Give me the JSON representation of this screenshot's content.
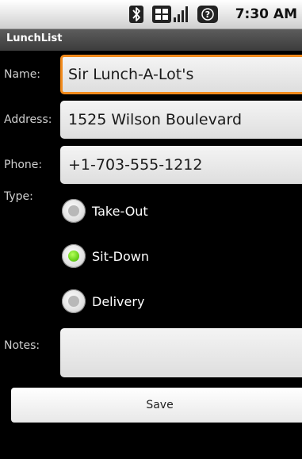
{
  "status_bar": {
    "time": "7:30 AM",
    "icons": [
      "bluetooth-icon",
      "data-icon",
      "signal-icon",
      "battery-icon"
    ]
  },
  "app": {
    "title": "LunchList"
  },
  "form": {
    "name_label": "Name:",
    "name_value": "Sir Lunch-A-Lot's",
    "address_label": "Address:",
    "address_value": "1525 Wilson Boulevard",
    "phone_label": "Phone:",
    "phone_value": "+1-703-555-1212",
    "type_label": "Type:",
    "type_options": [
      {
        "label": "Take-Out",
        "checked": false
      },
      {
        "label": "Sit-Down",
        "checked": true
      },
      {
        "label": "Delivery",
        "checked": false
      }
    ],
    "notes_label": "Notes:",
    "notes_value": "",
    "save_label": "Save"
  },
  "colors": {
    "focus_border": "#f18a1c",
    "radio_checked": "#6ad21a",
    "background": "#000000"
  }
}
